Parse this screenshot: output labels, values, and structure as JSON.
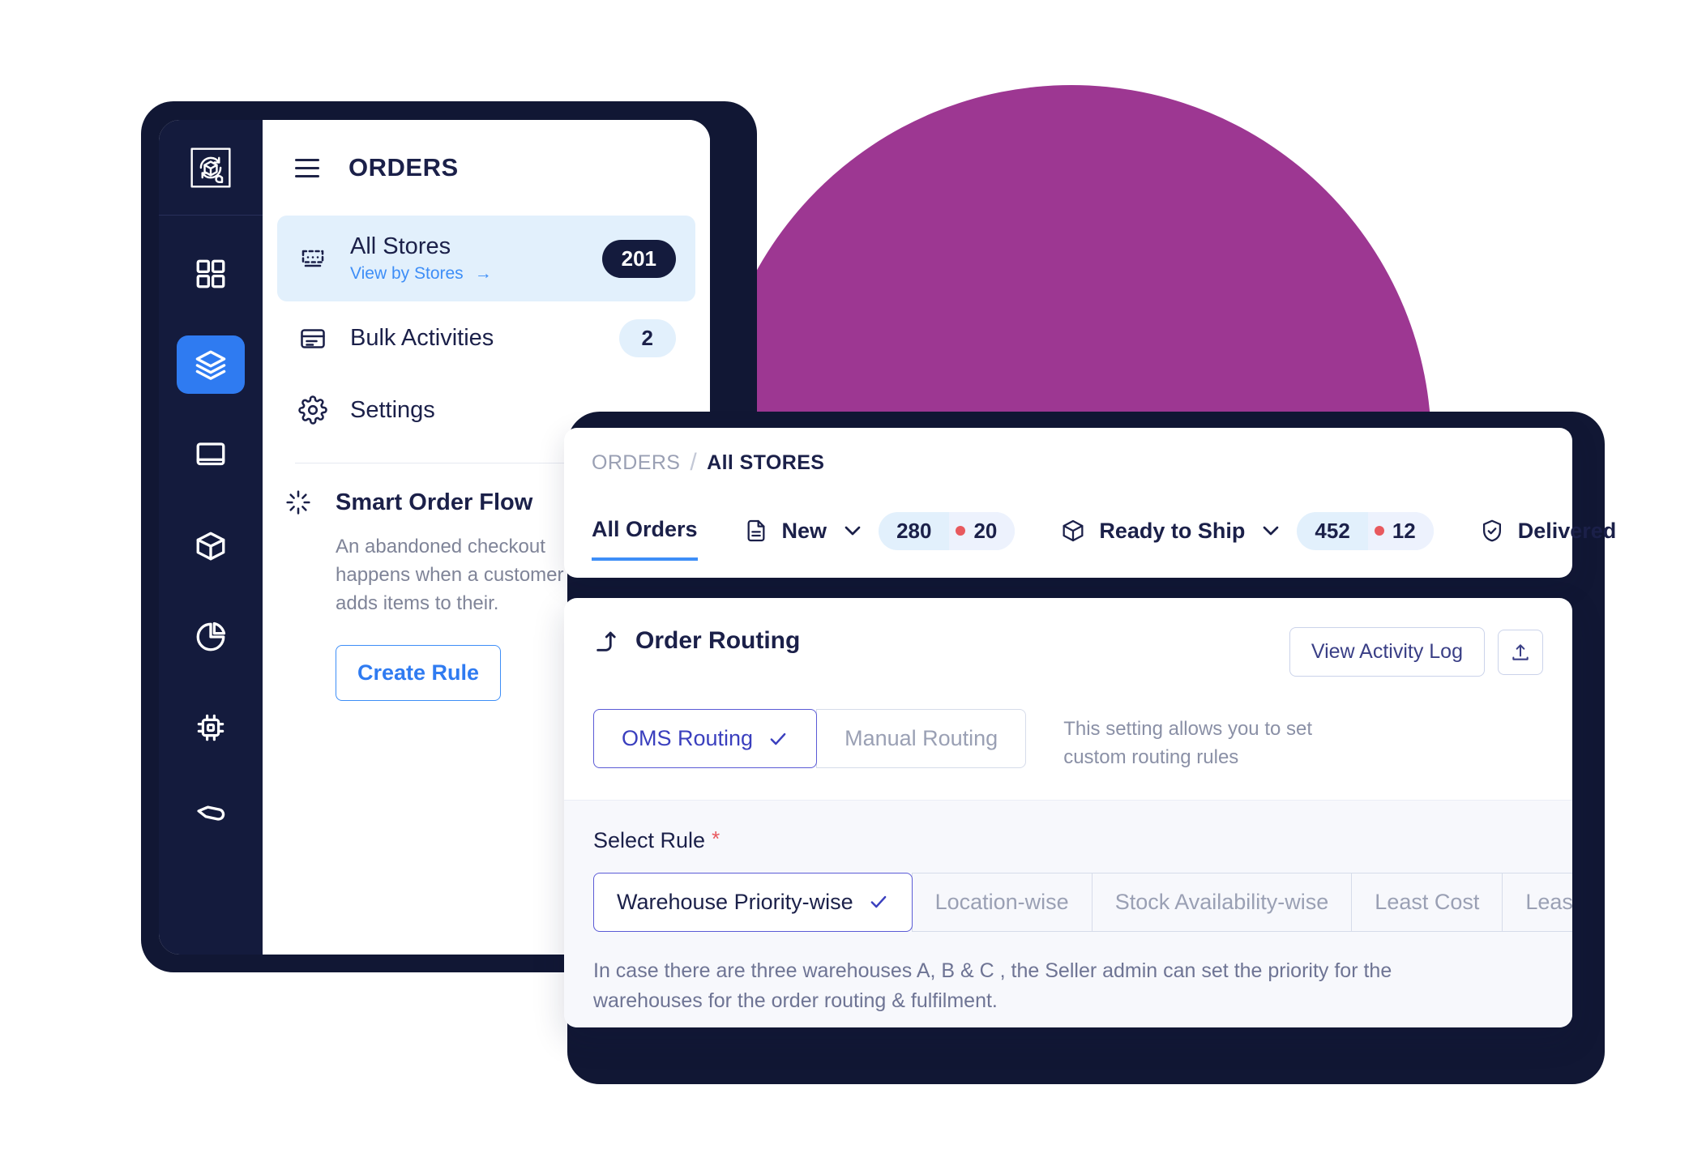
{
  "decor": {
    "circle_color": "#9D3792",
    "frame_color": "#111734",
    "accent_blue": "#2F7BF1"
  },
  "left_window": {
    "rail": {
      "logo_name": "app-logo",
      "items": [
        {
          "icon": "grid-dashboard-icon",
          "active": false
        },
        {
          "icon": "layers-icon",
          "active": true
        },
        {
          "icon": "book-icon",
          "active": false
        },
        {
          "icon": "package-box-icon",
          "active": false
        },
        {
          "icon": "pie-chart-icon",
          "active": false
        },
        {
          "icon": "chip-processor-icon",
          "active": false
        },
        {
          "icon": "tag-icon",
          "active": false
        }
      ]
    },
    "header": {
      "menu_icon": "hamburger-icon",
      "title": "ORDERS"
    },
    "menu": [
      {
        "label": "All Stores",
        "sublabel": "View by Stores",
        "sub_arrow": "→",
        "badge": "201",
        "badge_style": "dark",
        "icon": "stores-icon",
        "selected": true
      },
      {
        "label": "Bulk Activities",
        "badge": "2",
        "badge_style": "light",
        "icon": "bulk-activities-icon",
        "selected": false
      },
      {
        "label": "Settings",
        "badge": "",
        "badge_style": "none",
        "icon": "gear-icon",
        "selected": false
      }
    ],
    "smart_flow": {
      "icon": "sparkle-loader-icon",
      "title": "Smart Order Flow",
      "description": "An abandoned checkout happens when a customer adds items to their.",
      "button": "Create Rule"
    }
  },
  "tabs_card": {
    "breadcrumb": {
      "parent": "ORDERS",
      "separator": "/",
      "current": "All STORES"
    },
    "tabs": [
      {
        "label": "All Orders",
        "icon": "",
        "active": true,
        "has_chevron": false,
        "count": "",
        "alert_count": ""
      },
      {
        "label": "New",
        "icon": "document-icon",
        "active": false,
        "has_chevron": true,
        "count": "280",
        "alert_count": "20"
      },
      {
        "label": "Ready to Ship",
        "icon": "package-box-icon",
        "active": false,
        "has_chevron": true,
        "count": "452",
        "alert_count": "12"
      },
      {
        "label": "Delivered",
        "icon": "check-shield-icon",
        "active": false,
        "has_chevron": false,
        "count": "",
        "alert_count": ""
      }
    ]
  },
  "routing_card": {
    "icon": "route-arrow-icon",
    "title": "Order Routing",
    "view_activity_log": "View Activity Log",
    "export_icon": "upload-export-icon",
    "routing_modes": [
      {
        "label": "OMS Routing",
        "selected": true
      },
      {
        "label": "Manual Routing",
        "selected": false
      }
    ],
    "hint": "This setting allows you to set custom routing rules",
    "select_rule_label": "Select Rule",
    "required_marker": "*",
    "rules": [
      {
        "label": "Warehouse Priority-wise",
        "selected": true
      },
      {
        "label": "Location-wise",
        "selected": false
      },
      {
        "label": "Stock Availability-wise",
        "selected": false
      },
      {
        "label": "Least Cost",
        "selected": false
      },
      {
        "label": "Least Time",
        "selected": false
      }
    ],
    "note": "In case there are three warehouses A, B & C , the Seller admin can set the priority for the warehouses for the order routing & fulfilment."
  }
}
